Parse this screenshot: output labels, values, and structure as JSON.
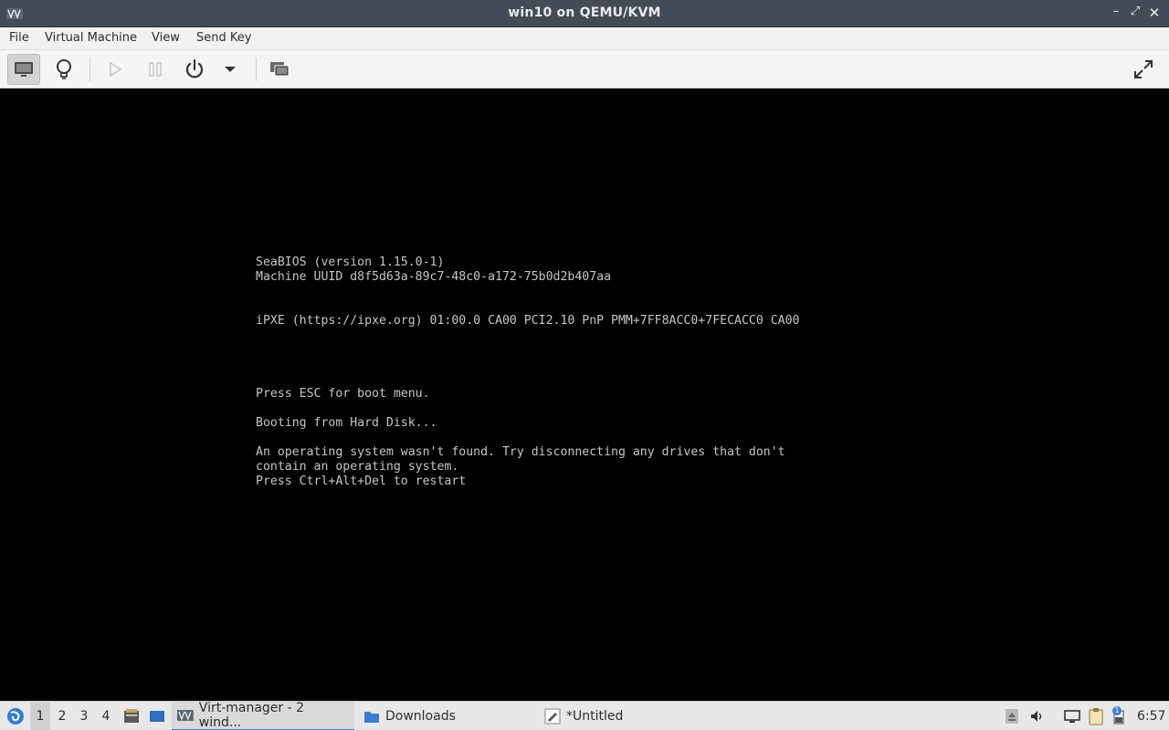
{
  "window": {
    "title": "win10 on QEMU/KVM",
    "controls": {
      "minimize": "–",
      "maximize": "⤢",
      "close": "✕"
    }
  },
  "menubar": {
    "items": [
      "File",
      "Virtual Machine",
      "View",
      "Send Key"
    ]
  },
  "toolbar": {
    "buttons": [
      {
        "name": "show-console-button",
        "icon": "monitor-icon",
        "state": "active"
      },
      {
        "name": "show-details-button",
        "icon": "lightbulb-icon"
      },
      {
        "name": "run-button",
        "icon": "play-icon",
        "state": "disabled"
      },
      {
        "name": "pause-button",
        "icon": "pause-icon",
        "state": "disabled"
      },
      {
        "name": "shutdown-button",
        "icon": "power-icon"
      },
      {
        "name": "shutdown-menu-button",
        "icon": "chevron-down-icon"
      },
      {
        "name": "snapshots-button",
        "icon": "snapshots-icon"
      },
      {
        "name": "fullscreen-button",
        "icon": "fullscreen-icon"
      }
    ]
  },
  "console": {
    "lines": [
      "SeaBIOS (version 1.15.0-1)",
      "Machine UUID d8f5d63a-89c7-48c0-a172-75b0d2b407aa",
      "",
      "",
      "iPXE (https://ipxe.org) 01:00.0 CA00 PCI2.10 PnP PMM+7FF8ACC0+7FECACC0 CA00",
      "",
      "",
      "",
      "",
      "Press ESC for boot menu.",
      "",
      "Booting from Hard Disk...",
      "",
      "An operating system wasn't found. Try disconnecting any drives that don't",
      "contain an operating system.",
      "Press Ctrl+Alt+Del to restart"
    ]
  },
  "taskbar": {
    "workspaces": [
      "1",
      "2",
      "3",
      "4"
    ],
    "current_workspace": "1",
    "tasks": [
      {
        "label": "Virt-manager - 2 wind...",
        "icon": "virt-manager-icon",
        "active": true
      },
      {
        "label": "Downloads",
        "icon": "folder-icon"
      },
      {
        "label": "*Untitled",
        "icon": "text-editor-icon"
      }
    ],
    "tray": {
      "notification_badge": "1",
      "clock": "6:57"
    }
  },
  "colors": {
    "titlebar": "#434c56",
    "console_text": "#c6c6c6",
    "taskbar": "#e8e8e8",
    "accent": "#3b7dd8"
  }
}
